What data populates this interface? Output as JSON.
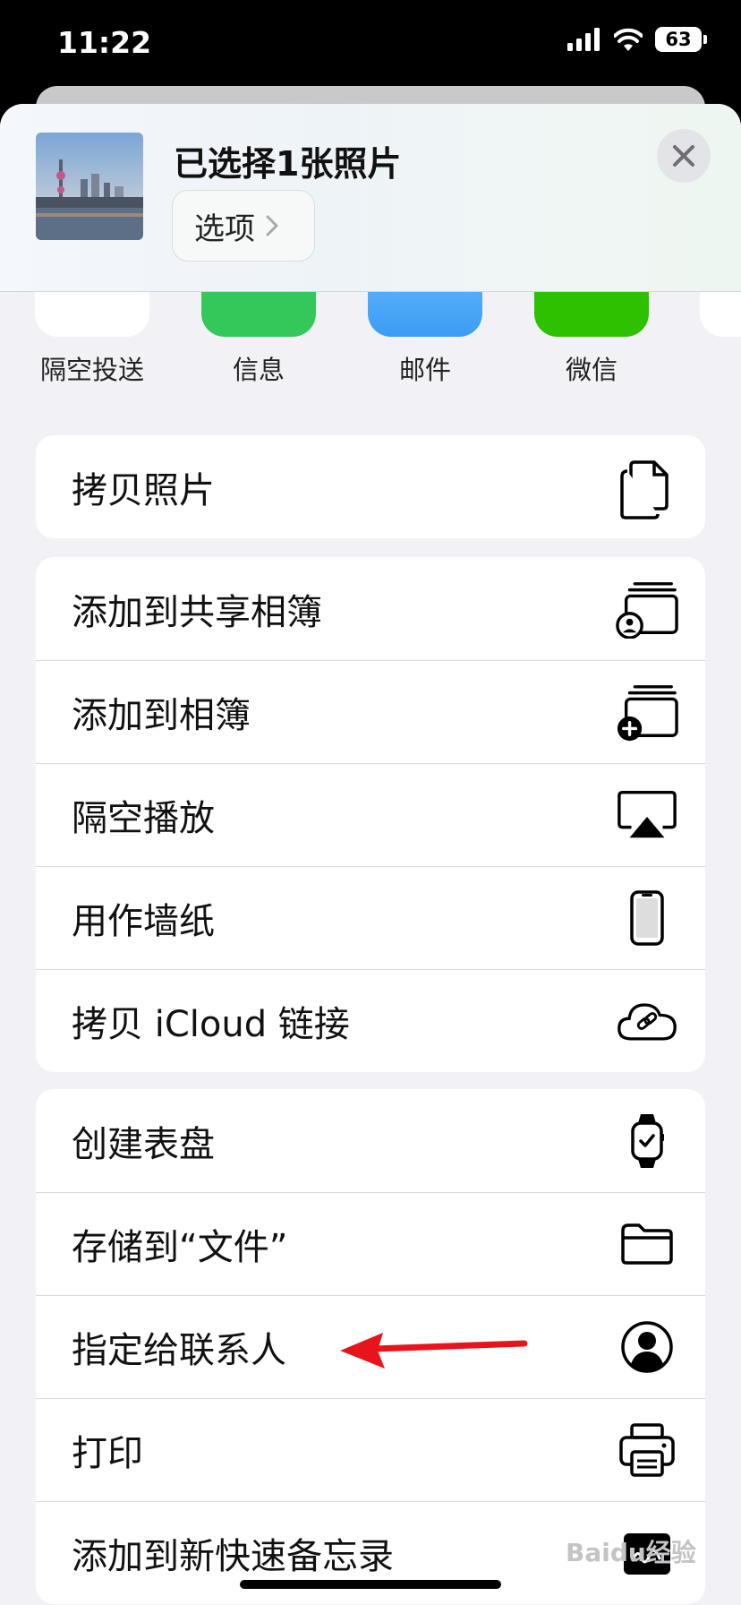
{
  "status_bar": {
    "time": "11:22",
    "battery": "63"
  },
  "header": {
    "title": "已选择1张照片",
    "options_label": "选项"
  },
  "apps": [
    {
      "label": "隔空投送",
      "icon": "airdrop-icon",
      "color": "#ffffff"
    },
    {
      "label": "信息",
      "icon": "messages-icon",
      "color": "#34c759"
    },
    {
      "label": "邮件",
      "icon": "mail-icon",
      "color": "#3b9cf6"
    },
    {
      "label": "微信",
      "icon": "wechat-icon",
      "color": "#2dc100"
    }
  ],
  "groups": [
    [
      {
        "label": "拷贝照片",
        "icon": "copy-icon"
      }
    ],
    [
      {
        "label": "添加到共享相簿",
        "icon": "shared-album-icon"
      },
      {
        "label": "添加到相簿",
        "icon": "add-album-icon"
      },
      {
        "label": "隔空播放",
        "icon": "airplay-icon"
      },
      {
        "label": "用作墙纸",
        "icon": "phone-icon"
      },
      {
        "label": "拷贝 iCloud 链接",
        "icon": "cloud-link-icon"
      }
    ],
    [
      {
        "label": "创建表盘",
        "icon": "watch-icon"
      },
      {
        "label": "存储到“文件”",
        "icon": "folder-icon"
      },
      {
        "label": "指定给联系人",
        "icon": "contact-icon"
      },
      {
        "label": "打印",
        "icon": "printer-icon"
      },
      {
        "label": "添加到新快速备忘录",
        "icon": "quick-note-icon"
      }
    ]
  ],
  "watermark": "Baidu经验",
  "colors": {
    "arrow": "#e8141b",
    "sheet_bg": "#f2f2f6"
  }
}
